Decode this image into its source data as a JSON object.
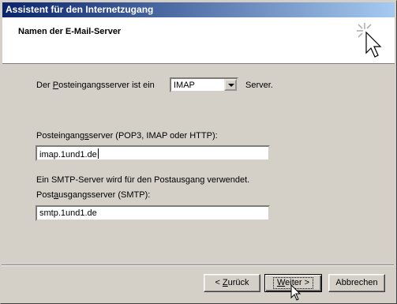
{
  "window": {
    "title": "Assistent für den Internetzugang"
  },
  "header": {
    "page_title": "Namen der E-Mail-Server"
  },
  "incoming_type": {
    "label_pre": "Der ",
    "label_accel": "P",
    "label_post": "osteingangsserver ist ein",
    "selected": "IMAP",
    "suffix": "Server."
  },
  "incoming_server": {
    "label_pre": "Posteingang",
    "label_accel": "s",
    "label_post": "server (POP3, IMAP oder HTTP):",
    "value": "imap.1und1.de"
  },
  "smtp_note": "Ein SMTP-Server wird für den Postausgang verwendet.",
  "outgoing_server": {
    "label_pre": "Post",
    "label_accel": "a",
    "label_post": "usgangsserver (SMTP):",
    "value": "smtp.1und1.de"
  },
  "buttons": {
    "back_lt": "< ",
    "back_accel": "Z",
    "back_rest": "urück",
    "next_accel": "W",
    "next_rest": "eiter >",
    "cancel": "Abbrechen"
  },
  "colors": {
    "title_start": "#0a246a",
    "title_end": "#a6caf0",
    "face": "#d4d0c8"
  }
}
